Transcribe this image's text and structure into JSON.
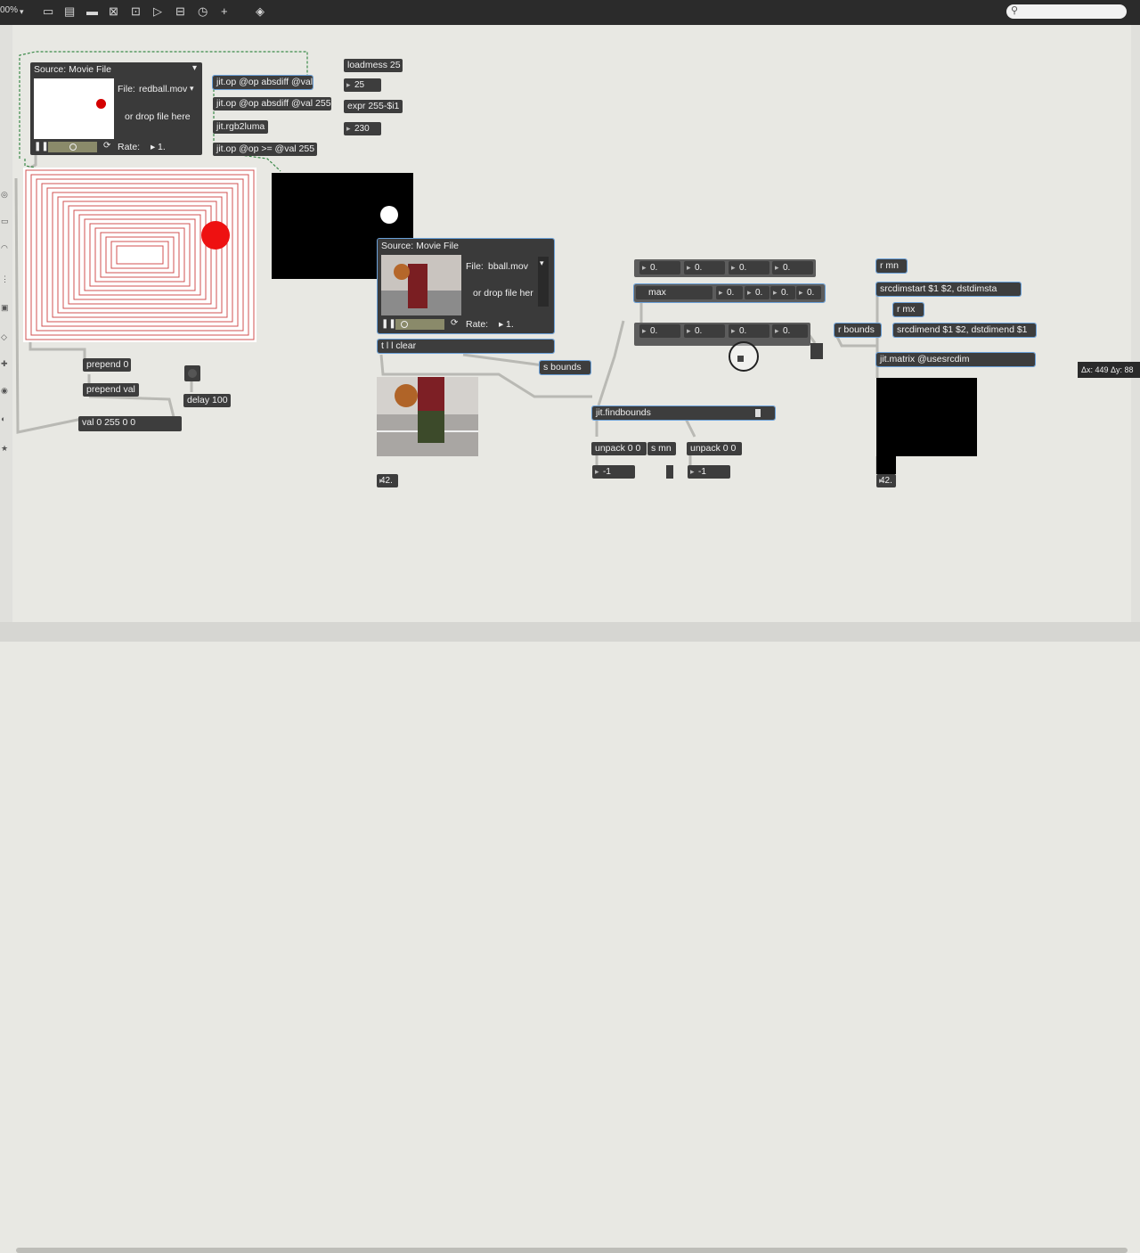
{
  "toolbar": {
    "zoom": "00%",
    "icons": [
      "presentation-icon",
      "patch-icon",
      "comment-icon",
      "object-icon",
      "message-icon",
      "toggle-icon",
      "button-icon",
      "inspector-icon",
      "add-icon",
      "paint-icon"
    ],
    "search_placeholder": ""
  },
  "left_movie": {
    "title": "Source: Movie File",
    "file_label": "File:",
    "file_name": "redball.mov",
    "drop_text": "or drop file here",
    "rate_label": "Rate:",
    "rate_value": "1."
  },
  "center_movie": {
    "title": "Source: Movie File",
    "file_label": "File:",
    "file_name": "bball.mov",
    "drop_text": "or drop file her",
    "rate_label": "Rate:",
    "rate_value": "1."
  },
  "objects": {
    "jit_op_absdiff": "jit.op @op absdiff @val",
    "jit_op_absdiff_255": "jit.op @op absdiff @val 255",
    "jit_rgb2luma": "jit.rgb2luma",
    "jit_op_gte": "jit.op @op >= @val 255",
    "loadmess": "loadmess 25",
    "num_25": "25",
    "expr": "expr 255-$i1",
    "num_230": "230",
    "prepend_0": "prepend 0",
    "prepend_val": "prepend val",
    "delay": "delay 100",
    "val_msg": "val 0 255 0 0",
    "t_l_l_clear": "t l l clear",
    "s_bounds": "s bounds",
    "jit_findbounds": "jit.findbounds",
    "unpack_1": "unpack 0 0",
    "s_mn": "s mn",
    "unpack_2": "unpack 0 0",
    "neg1_a": "-1",
    "neg1_b": "-1",
    "max": "max",
    "r_mn": "r mn",
    "srcdimstart": "srcdimstart $1 $2, dstdimsta",
    "r_mx": "r mx",
    "r_bounds": "r bounds",
    "srcdimend": "srcdimend $1 $2, dstdimend $1",
    "jit_matrix": "jit.matrix @usesrcdim",
    "val_42_a": "42.",
    "val_42_b": "42."
  },
  "numbers_row1": [
    "0.",
    "0.",
    "0.",
    "0."
  ],
  "numbers_max": [
    "0.",
    "0.",
    "0.",
    "0."
  ],
  "numbers_row2": [
    "0.",
    "0.",
    "0.",
    "0."
  ],
  "hud": "Δx: 449 Δy: 88"
}
